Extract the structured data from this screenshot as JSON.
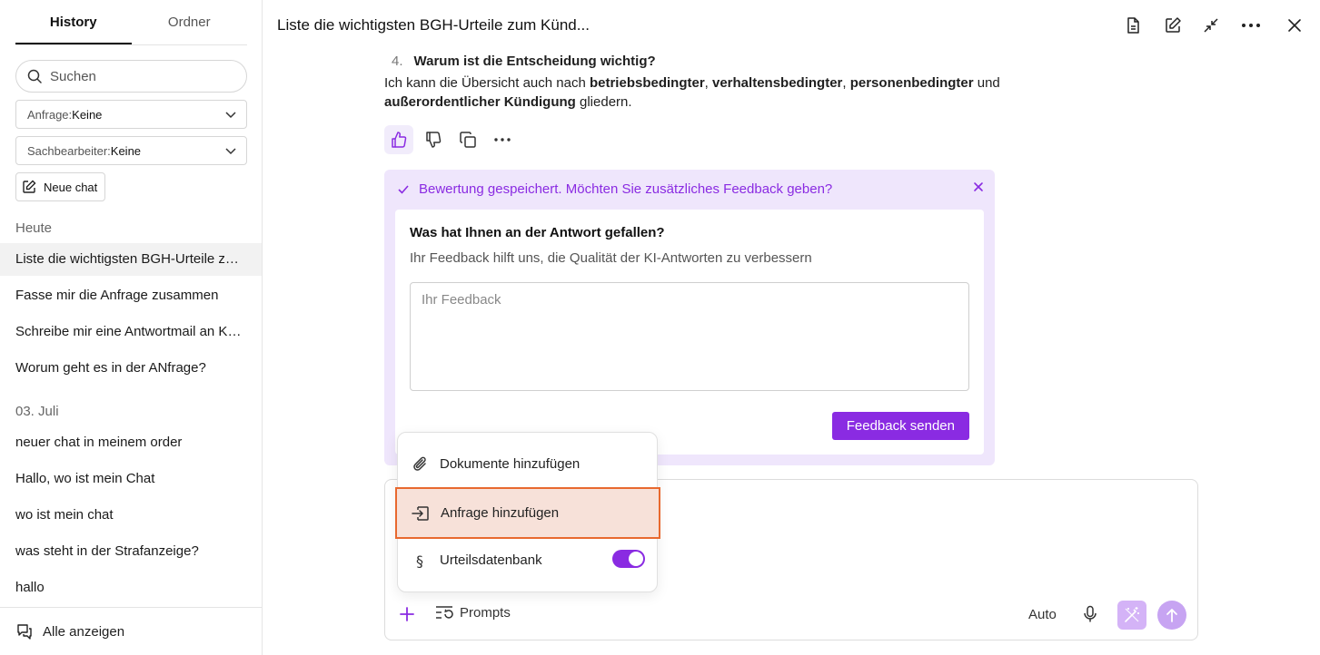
{
  "sidebar": {
    "tabs": [
      {
        "label": "History",
        "active": true
      },
      {
        "label": "Ordner",
        "active": false
      }
    ],
    "search": {
      "placeholder": "Suchen"
    },
    "filters": [
      {
        "label": "Anfrage:",
        "value": "Keine"
      },
      {
        "label": "Sachbearbeiter:",
        "value": "Keine"
      }
    ],
    "new_chat_label": "Neue chat",
    "groups": [
      {
        "label": "Heute",
        "items": [
          "Liste die wichtigsten BGH-Urteile zum Kündigungsschutz",
          "Fasse mir die Anfrage zusammen",
          "Schreibe mir eine Antwortmail an Kr…",
          "Worum geht es in der ANfrage?"
        ]
      },
      {
        "label": "03. Juli",
        "items": [
          "neuer chat in meinem order",
          "Hallo, wo ist mein Chat",
          "wo ist mein chat",
          "was steht in der Strafanzeige?",
          "hallo"
        ]
      }
    ],
    "footer_label": "Alle anzeigen"
  },
  "header": {
    "title": "Liste die wichtigsten BGH-Urteile zum Künd..."
  },
  "message": {
    "list_number": "4.",
    "list_heading": "Warum ist die Entscheidung wichtig?",
    "p_intro": "Ich kann die Übersicht auch nach ",
    "b1": "betriebsbedingter",
    "sep1": ", ",
    "b2": "verhaltensbedingter",
    "sep2": ", ",
    "b3": "personenbedingter",
    "p_and": " und",
    "b4": "außerordentlicher Kündigung",
    "p_end": " gliedern."
  },
  "feedback": {
    "saved_text": "Bewertung gespeichert. Möchten Sie zusätzliches Feedback geben?",
    "question": "Was hat Ihnen an der Antwort gefallen?",
    "subtitle": "Ihr Feedback hilft uns, die Qualität der KI-Antworten zu verbessern",
    "placeholder": "Ihr Feedback",
    "submit_label": "Feedback senden"
  },
  "menu": {
    "items": [
      {
        "label": "Dokumente hinzufügen",
        "icon": "paperclip-icon"
      },
      {
        "label": "Anfrage hinzufügen",
        "icon": "import-icon",
        "highlighted": true
      },
      {
        "label": "Urteilsdatenbank",
        "icon": "paragraph-icon",
        "toggle_on": true
      }
    ]
  },
  "composer": {
    "prompts_label": "Prompts",
    "mode_label": "Auto"
  },
  "colors": {
    "accent": "#8a2be2",
    "feedback_bg": "#efe6fc",
    "highlight_border": "#e8692f",
    "highlight_bg": "#f7e1d9"
  }
}
